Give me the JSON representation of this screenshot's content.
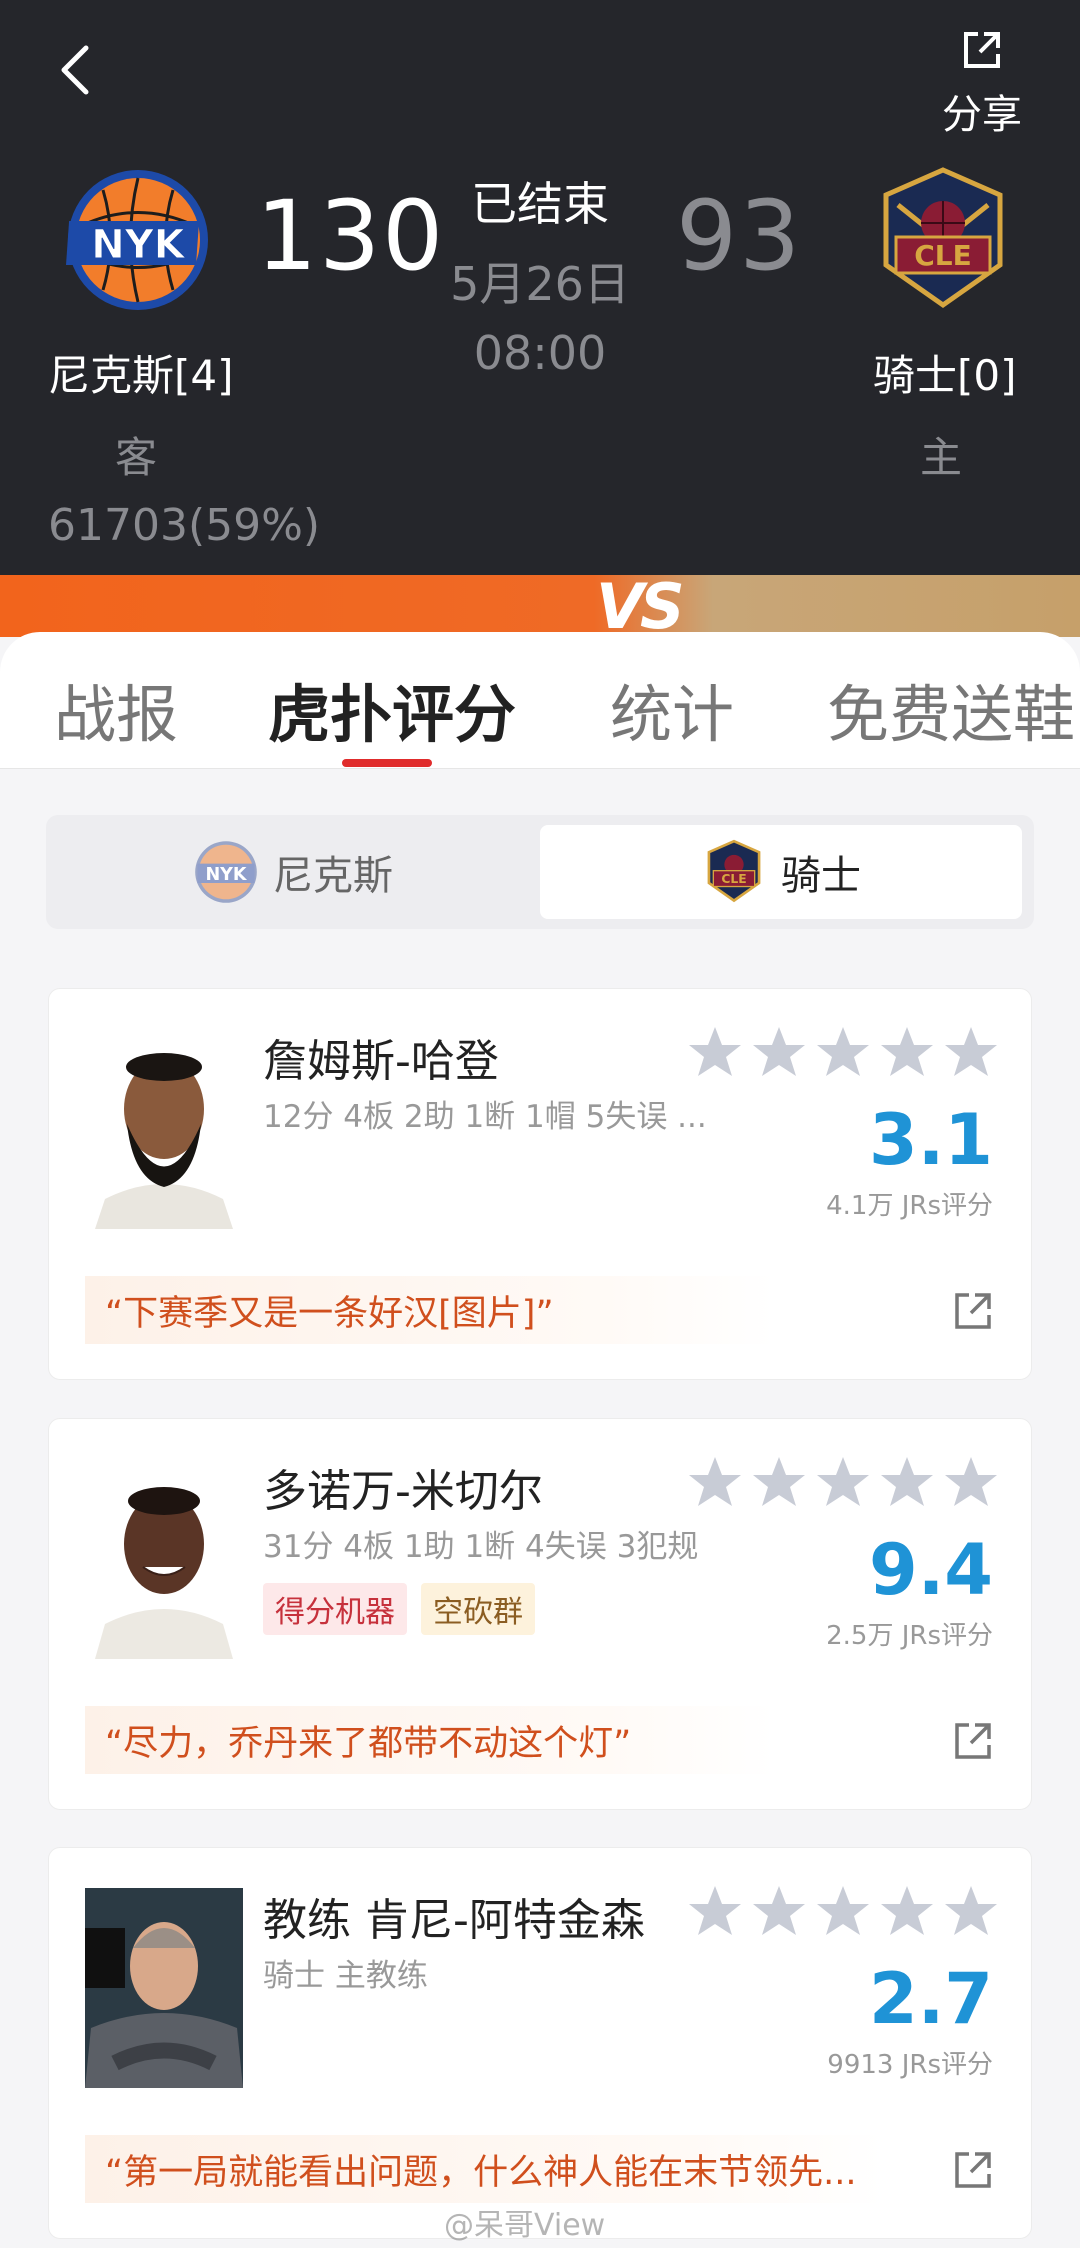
{
  "header": {
    "share_label": "分享",
    "status": "已结束",
    "date": "5月26日",
    "time": "08:00",
    "home_team": {
      "name": "尼克斯[4]",
      "side": "客",
      "score": "130",
      "logo": "NYK",
      "support": "61703(59%)"
    },
    "away_team": {
      "name": "骑士[0]",
      "side": "主",
      "score": "93",
      "logo": "CLE"
    },
    "vs_text": "VS"
  },
  "tabs": [
    "战报",
    "虎扑评分",
    "统计",
    "免费送鞋"
  ],
  "active_tab": "虎扑评分",
  "team_toggle": {
    "options": [
      "尼克斯",
      "骑士"
    ],
    "selected": "骑士"
  },
  "cards": [
    {
      "name": "詹姆斯-哈登",
      "stats": "12分 4板 2助 1断 1帽 5失误 ...",
      "rating": "3.1",
      "votes": "4.1万 JRs评分",
      "quote": "“下赛季又是一条好汉[图片]”",
      "tags": []
    },
    {
      "name": "多诺万-米切尔",
      "stats": "31分 4板 1助 1断 4失误 3犯规",
      "rating": "9.4",
      "votes": "2.5万 JRs评分",
      "quote": "“尽力，乔丹来了都带不动这个灯”",
      "tags": [
        "得分机器",
        "空砍群"
      ]
    },
    {
      "name": "教练 肯尼-阿特金森",
      "stats": "骑士 主教练",
      "rating": "2.7",
      "votes": "9913 JRs评分",
      "quote": "“第一局就能看出问题，什么神人能在末节领先...",
      "tags": []
    }
  ],
  "watermark": "@呆哥View",
  "colors": {
    "accent": "#1f93d6",
    "tab_underline": "#e02c2c",
    "quote_text": "#d04f1d",
    "header_bg": "#25262b"
  }
}
